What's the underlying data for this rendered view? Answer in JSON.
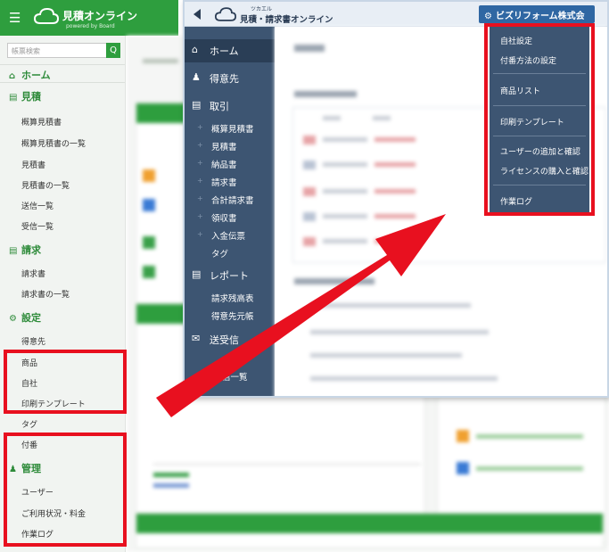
{
  "old_app": {
    "title": "見積オンライン",
    "subtitle": "powered by Board",
    "search_placeholder": "帳票検索",
    "search_button": "Q",
    "home": "ホーム",
    "sections": {
      "quote": "見積",
      "invoice": "請求",
      "settings": "設定",
      "admin": "管理"
    },
    "quote_items": [
      "概算見積書",
      "概算見積書の一覧",
      "見積書",
      "見積書の一覧",
      "送信一覧",
      "受信一覧"
    ],
    "invoice_items": [
      "請求書",
      "請求書の一覧"
    ],
    "settings_items": [
      "得意先",
      "商品",
      "自社",
      "印刷テンプレート",
      "タグ",
      "付番"
    ],
    "admin_items": [
      "ユーザー",
      "ご利用状況・料金",
      "作業ログ"
    ]
  },
  "new_app": {
    "brand_small": "ツカエル",
    "brand": "見積・請求書オンライン",
    "company_button": "ビズリフォーム株式会社",
    "nav": {
      "home": "ホーム",
      "customers": "得意先",
      "transactions": "取引",
      "reports": "レポート",
      "send_receive": "送受信"
    },
    "transaction_items": [
      "概算見積書",
      "見積書",
      "納品書",
      "請求書",
      "合計請求書",
      "領収書",
      "入金伝票",
      "タグ"
    ],
    "report_items": [
      "請求残高表",
      "得意先元帳"
    ],
    "send_items_partial": "信一覧"
  },
  "dropdown": {
    "items_group1": [
      "自社設定",
      "付番方法の設定"
    ],
    "items_group2": [
      "商品リスト"
    ],
    "items_group3": [
      "印刷テンプレート"
    ],
    "items_group4": [
      "ユーザーの追加と確認",
      "ライセンスの購入と確認"
    ],
    "items_group5": [
      "作業ログ"
    ]
  },
  "colors": {
    "old_green": "#2e9e3e",
    "new_navy": "#3d5572",
    "company_blue": "#2f67a3",
    "highlight_red": "#e8101f"
  }
}
